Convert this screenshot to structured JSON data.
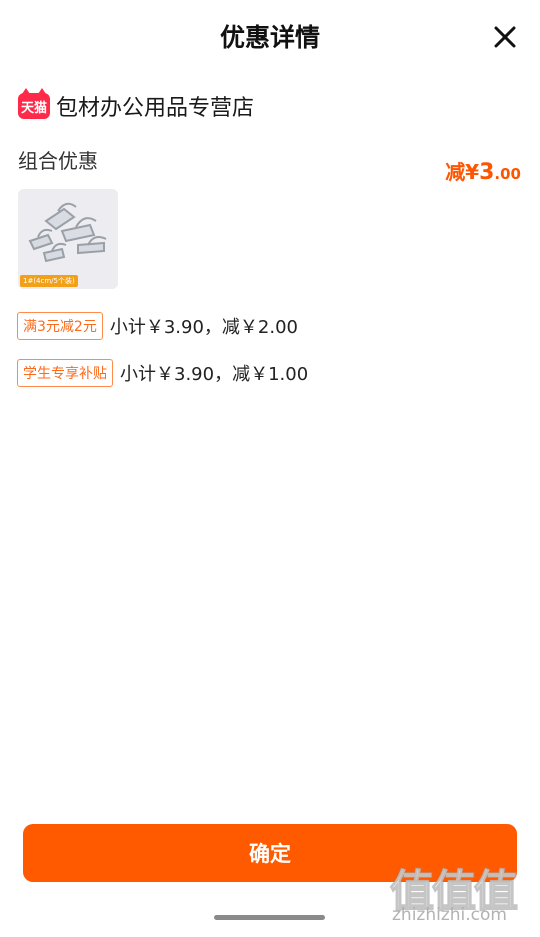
{
  "header": {
    "title": "优惠详情",
    "close_icon": "close-icon"
  },
  "shop": {
    "badge": "天猫",
    "badge_color": "#ff2a4a",
    "name": "包材办公用品专营店"
  },
  "combo": {
    "label": "组合优惠",
    "discount_prefix": "减¥",
    "discount_int": "3",
    "discount_dec": ".00"
  },
  "product": {
    "thumb_caption": "1#(4cm/5个装)"
  },
  "promotions": [
    {
      "tag": "满3元减2元",
      "text": "小计￥3.90，减￥2.00"
    },
    {
      "tag": "学生专享补贴",
      "text": "小计￥3.90，减￥1.00"
    }
  ],
  "footer": {
    "confirm_label": "确定",
    "accent_color": "#ff5a00"
  },
  "watermark": {
    "logo": "值值值",
    "url": "zhizhizhi.com"
  }
}
